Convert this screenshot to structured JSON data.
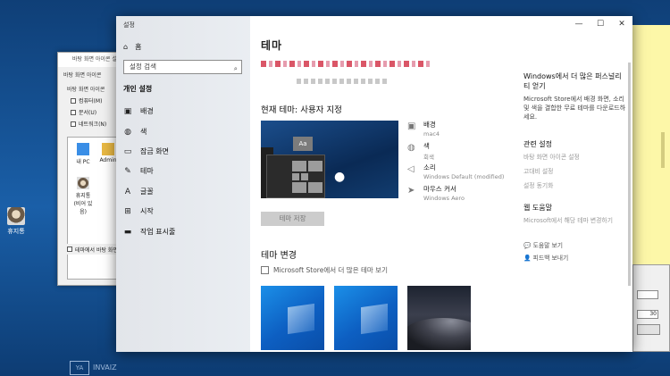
{
  "desktop": {
    "icon_label": "휴지통",
    "bottom_logo": {
      "mark": "YA",
      "text": "INVAIZ"
    }
  },
  "bg_dialog": {
    "title": "바탕 화면 아이콘 설정",
    "tab": "바탕 화면 아이콘",
    "group": "바탕 화면 아이콘",
    "checks": [
      "컴퓨터(M)",
      "문서(U)",
      "네트워크(N)"
    ],
    "icons": [
      "내 PC",
      "Admin",
      "휴지통 (비어 있음)"
    ],
    "theme_check": "테마에서 바탕 화면"
  },
  "right_dialog": {
    "select1": "",
    "select2": "30"
  },
  "settings": {
    "window_title": "설정",
    "window_controls": [
      "—",
      "☐",
      "✕"
    ],
    "nav": {
      "home": "홈",
      "search_placeholder": "설정 검색",
      "section": "개인 설정",
      "items": [
        {
          "label": "배경",
          "icon": "image-icon"
        },
        {
          "label": "색",
          "icon": "palette-icon"
        },
        {
          "label": "잠금 화면",
          "icon": "lock-screen-icon"
        },
        {
          "label": "테마",
          "icon": "theme-icon"
        },
        {
          "label": "글꼴",
          "icon": "font-icon"
        },
        {
          "label": "시작",
          "icon": "start-icon"
        },
        {
          "label": "작업 표시줄",
          "icon": "taskbar-icon"
        }
      ]
    },
    "page_title": "테마",
    "current_theme_label": "현재 테마: 사용자 지정",
    "theme_preview_tile": "Aa",
    "props": [
      {
        "label": "배경",
        "value": "mac4",
        "icon": "image-icon"
      },
      {
        "label": "색",
        "value": "회색",
        "icon": "palette-icon"
      },
      {
        "label": "소리",
        "value": "Windows Default (modified)",
        "icon": "speaker-icon"
      },
      {
        "label": "마우스 커서",
        "value": "Windows Aero",
        "icon": "cursor-icon"
      }
    ],
    "save_button": "테마 저장",
    "change_theme_heading": "테마 변경",
    "store_link": "Microsoft Store에서 더 많은 테마 보기",
    "thumbnails": [
      "windows-blue",
      "windows-blue-2",
      "macos-mojave"
    ],
    "right": {
      "personalize_heading": "Windows에서 더 많은 퍼스널리티 얻기",
      "personalize_text": "Microsoft Store에서 배경 화면, 소리 및 색을 결합한 무료 테마를 다운로드하세요.",
      "related_heading": "관련 설정",
      "related_links": [
        "바탕 화면 아이콘 설정",
        "고대비 설정",
        "설정 동기화"
      ],
      "help_heading": "웹 도움말",
      "help_links": [
        "Microsoft에서 해당 테마 변경하기"
      ],
      "footer_links": [
        "도움말 보기",
        "피드백 보내기"
      ]
    }
  }
}
